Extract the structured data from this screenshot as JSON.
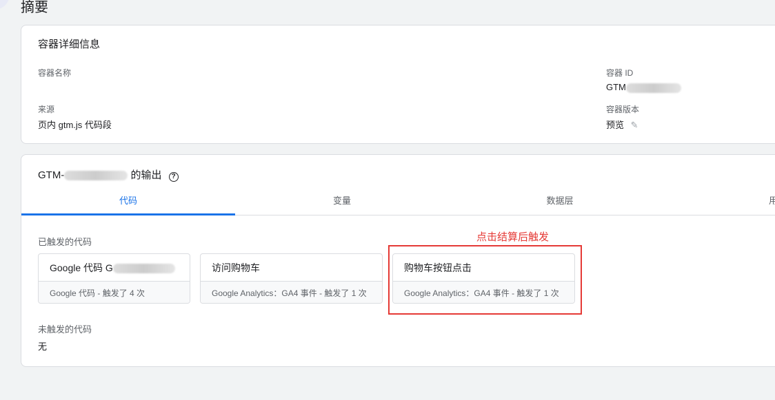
{
  "page_title": "摘要",
  "details": {
    "heading": "容器详细信息",
    "name_label": "容器名称",
    "name_value": "",
    "source_label": "来源",
    "source_value": "页内 gtm.js 代码段",
    "id_label": "容器 ID",
    "id_value": "GTM",
    "version_label": "容器版本",
    "version_value": "预览"
  },
  "output": {
    "heading_prefix": "GTM-",
    "heading_suffix": " 的输出",
    "tabs": [
      {
        "label": "代码"
      },
      {
        "label": "变量"
      },
      {
        "label": "数据层"
      },
      {
        "label": "用"
      }
    ],
    "fired_label": "已触发的代码",
    "tags": [
      {
        "name": "Google 代码 G",
        "desc": "Google 代码 - 触发了 4 次"
      },
      {
        "name": "访问购物车",
        "desc": "Google Analytics：GA4 事件 - 触发了 1 次"
      },
      {
        "name": "购物车按钮点击",
        "desc": "Google Analytics：GA4 事件 - 触发了 1 次"
      }
    ],
    "not_fired_label": "未触发的代码",
    "not_fired_value": "无"
  },
  "annotation": {
    "text": "点击结算后触发",
    "color": "#e53935"
  }
}
